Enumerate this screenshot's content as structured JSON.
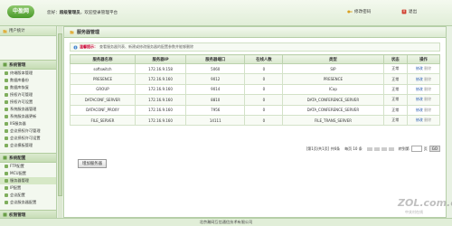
{
  "header": {
    "logo": "中盈网",
    "welcome_prefix": "您好：",
    "user": "超级管理员",
    "welcome_suffix": "，欢迎登录管理平台",
    "change_password": "修改密码",
    "logout": "退出"
  },
  "sidebar": {
    "top_item": "用户统计",
    "groups": [
      {
        "label": "系统管理",
        "items": [
          "终端版本管理",
          "数据库备份",
          "数据库恢复",
          "授权许可管理",
          "授权许可设置",
          "系统服务器管理",
          "系统服务器更新",
          "IIS服务器",
          "会议授权许可管理",
          "会议授权许可设置",
          "会议模板管理"
        ]
      },
      {
        "label": "系统配置",
        "items": [
          "FTP配置",
          "MCU配置",
          "服务器管理",
          "IP配置",
          "会议配置",
          "会议服务器配置"
        ]
      },
      {
        "label": "权限管理",
        "items": []
      }
    ],
    "active_item": "服务器管理"
  },
  "main": {
    "title": "服务器管理",
    "tip_label": "温馨提示：",
    "tip_text": "查看服务器列表、新建或修改服务器的配置参数并能够删除",
    "columns": [
      "服务器名称",
      "服务器IP",
      "服务器端口",
      "在线人数",
      "类型",
      "状态",
      "操作"
    ],
    "rows": [
      {
        "name": "softswitch",
        "ip": "172.16.9.158",
        "port": "5060",
        "online": "0",
        "type": "SIP",
        "status": "正常"
      },
      {
        "name": "PRESENCE",
        "ip": "172.16.9.160",
        "port": "9012",
        "online": "0",
        "type": "PRESENCE",
        "status": "正常"
      },
      {
        "name": "GROUP",
        "ip": "172.16.9.160",
        "port": "9014",
        "online": "0",
        "type": "ICap",
        "status": "正常"
      },
      {
        "name": "DATACONF_SERVER",
        "ip": "172.16.9.160",
        "port": "8810",
        "online": "0",
        "type": "DATA_CONFERENCE_SERVER",
        "status": "正常"
      },
      {
        "name": "DATACONF_PROXY",
        "ip": "172.16.9.160",
        "port": "7956",
        "online": "0",
        "type": "DATA_CONFERENCE_SERVER",
        "status": "正常"
      },
      {
        "name": "FILE_SERVER",
        "ip": "172.16.9.160",
        "port": "14111",
        "online": "0",
        "type": "FILE_TRANS_SERVER",
        "status": "正常"
      }
    ],
    "op_edit": "修改",
    "op_delete": "删除",
    "pager": {
      "info": "[第1页/共1页] 共6条",
      "per_page": "每页 10 条",
      "goto": "转到第",
      "page_unit": "页",
      "go": "GO"
    },
    "add_button": "增加服务器"
  },
  "footer": {
    "text": "北京瀚网互信通信技术有限公司"
  },
  "watermark": {
    "main": "ZOL.com.cn",
    "sub": "中关村在线"
  }
}
